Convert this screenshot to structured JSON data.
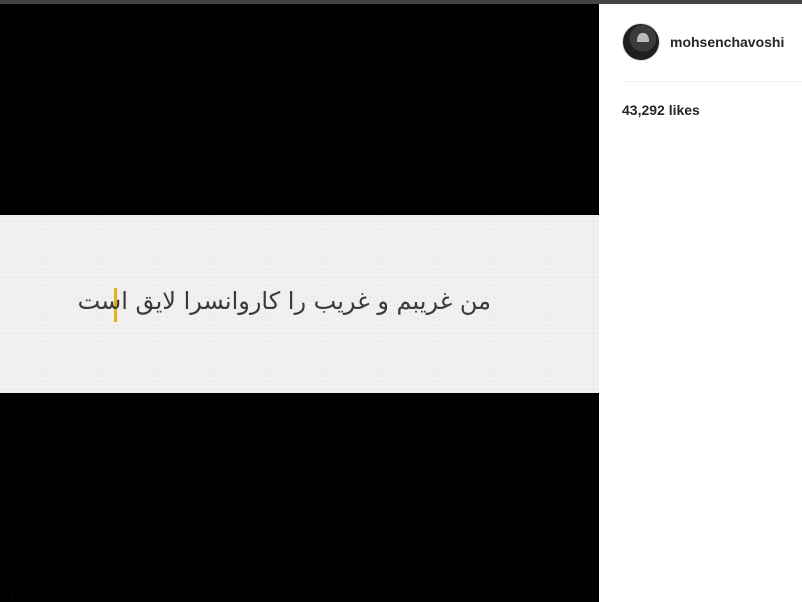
{
  "post": {
    "caption": "من غریبم و غریب را کاروانسرا لایق است",
    "cursor_color": "#e2b416",
    "background_color": "#000000",
    "panel_color": "#f1f1f0",
    "watermark": "..."
  },
  "sidebar": {
    "username": "mohsenchavoshi",
    "avatar_icon": "profile-avatar",
    "likes": "43,292 likes"
  }
}
